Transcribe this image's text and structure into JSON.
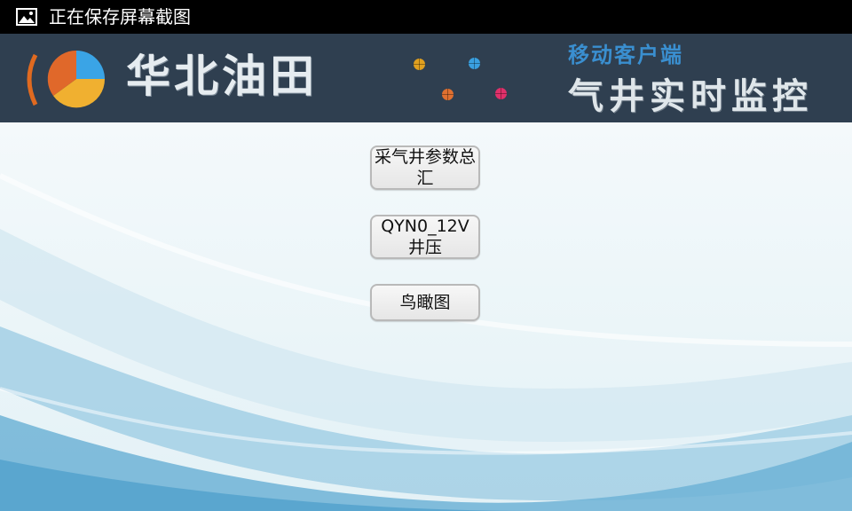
{
  "status_bar": {
    "notification_icon": "image-icon",
    "text": "正在保存屏幕截图"
  },
  "header": {
    "logo_icon": "pie-chart-logo-icon",
    "brand_name": "华北油田",
    "mobile_label": "移动客户端",
    "title": "气井实时监控",
    "dot_colors": [
      "#e0a020",
      "#3aa0e0",
      "#e07030",
      "#e0306a"
    ]
  },
  "buttons": [
    {
      "label": "采气井参数总汇"
    },
    {
      "label": "QYN0_12V井压"
    },
    {
      "label": "鸟瞰图"
    }
  ],
  "colors": {
    "header_bg": "#2f3f50",
    "accent_blue": "#3a8fd0",
    "wave_blue": "#6fb3d6"
  }
}
